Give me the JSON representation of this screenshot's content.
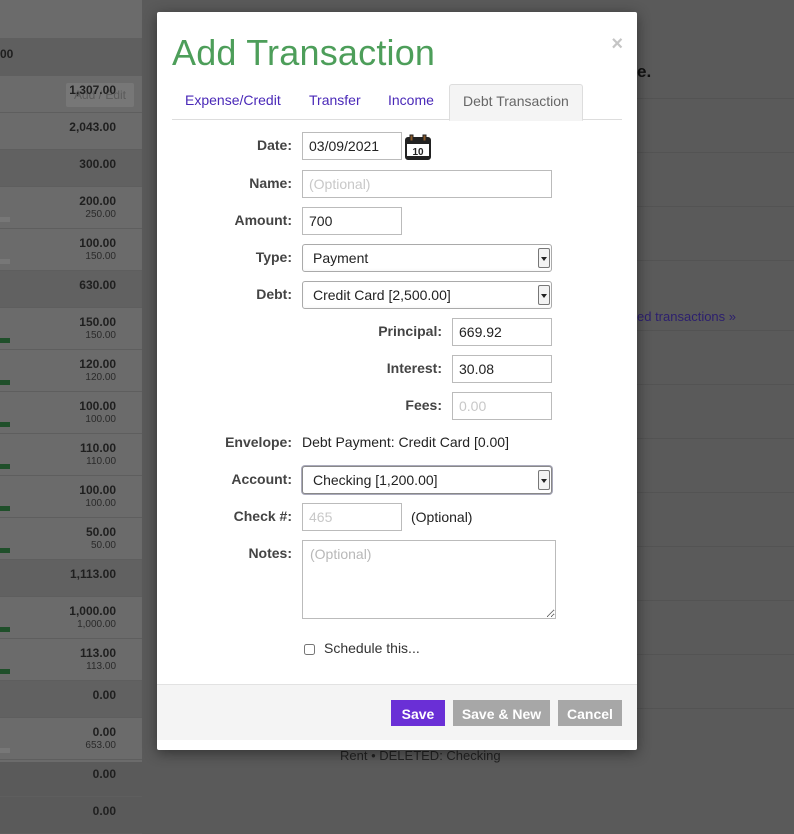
{
  "background": {
    "add_edit_label": "Add / Edit",
    "header_amount": "00",
    "rows": [
      {
        "amount": "1,307.00",
        "sub": "",
        "bar": "none",
        "group": false
      },
      {
        "amount": "2,043.00",
        "sub": "",
        "bar": "none",
        "group": false
      },
      {
        "amount": "300.00",
        "sub": "",
        "bar": "none",
        "group": true
      },
      {
        "amount": "200.00",
        "sub": "250.00",
        "bar": "grey",
        "group": false
      },
      {
        "amount": "100.00",
        "sub": "150.00",
        "bar": "grey",
        "group": false
      },
      {
        "amount": "630.00",
        "sub": "",
        "bar": "none",
        "group": true
      },
      {
        "amount": "150.00",
        "sub": "150.00",
        "bar": "green",
        "group": false
      },
      {
        "amount": "120.00",
        "sub": "120.00",
        "bar": "green",
        "group": false
      },
      {
        "amount": "100.00",
        "sub": "100.00",
        "bar": "green",
        "group": false
      },
      {
        "amount": "110.00",
        "sub": "110.00",
        "bar": "green",
        "group": false
      },
      {
        "amount": "100.00",
        "sub": "100.00",
        "bar": "green",
        "group": false
      },
      {
        "amount": "50.00",
        "sub": "50.00",
        "bar": "green",
        "group": false
      },
      {
        "amount": "1,113.00",
        "sub": "",
        "bar": "none",
        "group": true
      },
      {
        "amount": "1,000.00",
        "sub": "1,000.00",
        "bar": "green",
        "group": false
      },
      {
        "amount": "113.00",
        "sub": "113.00",
        "bar": "green",
        "group": false
      },
      {
        "amount": "0.00",
        "sub": "",
        "bar": "none",
        "group": true
      },
      {
        "amount": "0.00",
        "sub": "653.00",
        "bar": "grey",
        "group": false
      },
      {
        "amount": "0.00",
        "sub": "",
        "bar": "none",
        "group": false
      },
      {
        "amount": "0.00",
        "sub": "",
        "bar": "none",
        "group": false
      }
    ],
    "right_heading": "e.",
    "right_link": "ed transactions »",
    "bottom_text": "Rent • DELETED: Checking"
  },
  "modal": {
    "title": "Add Transaction",
    "close": "×",
    "tabs": [
      {
        "label": "Expense/Credit",
        "active": false
      },
      {
        "label": "Transfer",
        "active": false
      },
      {
        "label": "Income",
        "active": false
      },
      {
        "label": "Debt Transaction",
        "active": true
      }
    ],
    "form": {
      "date_label": "Date:",
      "date_value": "03/09/2021",
      "calendar_day": "10",
      "name_label": "Name:",
      "name_placeholder": "(Optional)",
      "amount_label": "Amount:",
      "amount_value": "700",
      "type_label": "Type:",
      "type_value": "Payment",
      "debt_label": "Debt:",
      "debt_value": "Credit Card [2,500.00]",
      "principal_label": "Principal:",
      "principal_value": "669.92",
      "interest_label": "Interest:",
      "interest_value": "30.08",
      "fees_label": "Fees:",
      "fees_placeholder": "0.00",
      "envelope_label": "Envelope:",
      "envelope_value": "Debt Payment: Credit Card [0.00]",
      "account_label": "Account:",
      "account_value": "Checking [1,200.00]",
      "check_label": "Check #:",
      "check_placeholder": "465",
      "check_optional": "(Optional)",
      "notes_label": "Notes:",
      "notes_placeholder": "(Optional)",
      "schedule_label": "Schedule this..."
    },
    "buttons": {
      "save": "Save",
      "save_new": "Save & New",
      "cancel": "Cancel"
    }
  },
  "colors": {
    "title_green": "#4d9e5a",
    "tab_link": "#4a29b8",
    "save_purple": "#6a2fd6",
    "grey_button": "#a7a7a7"
  }
}
